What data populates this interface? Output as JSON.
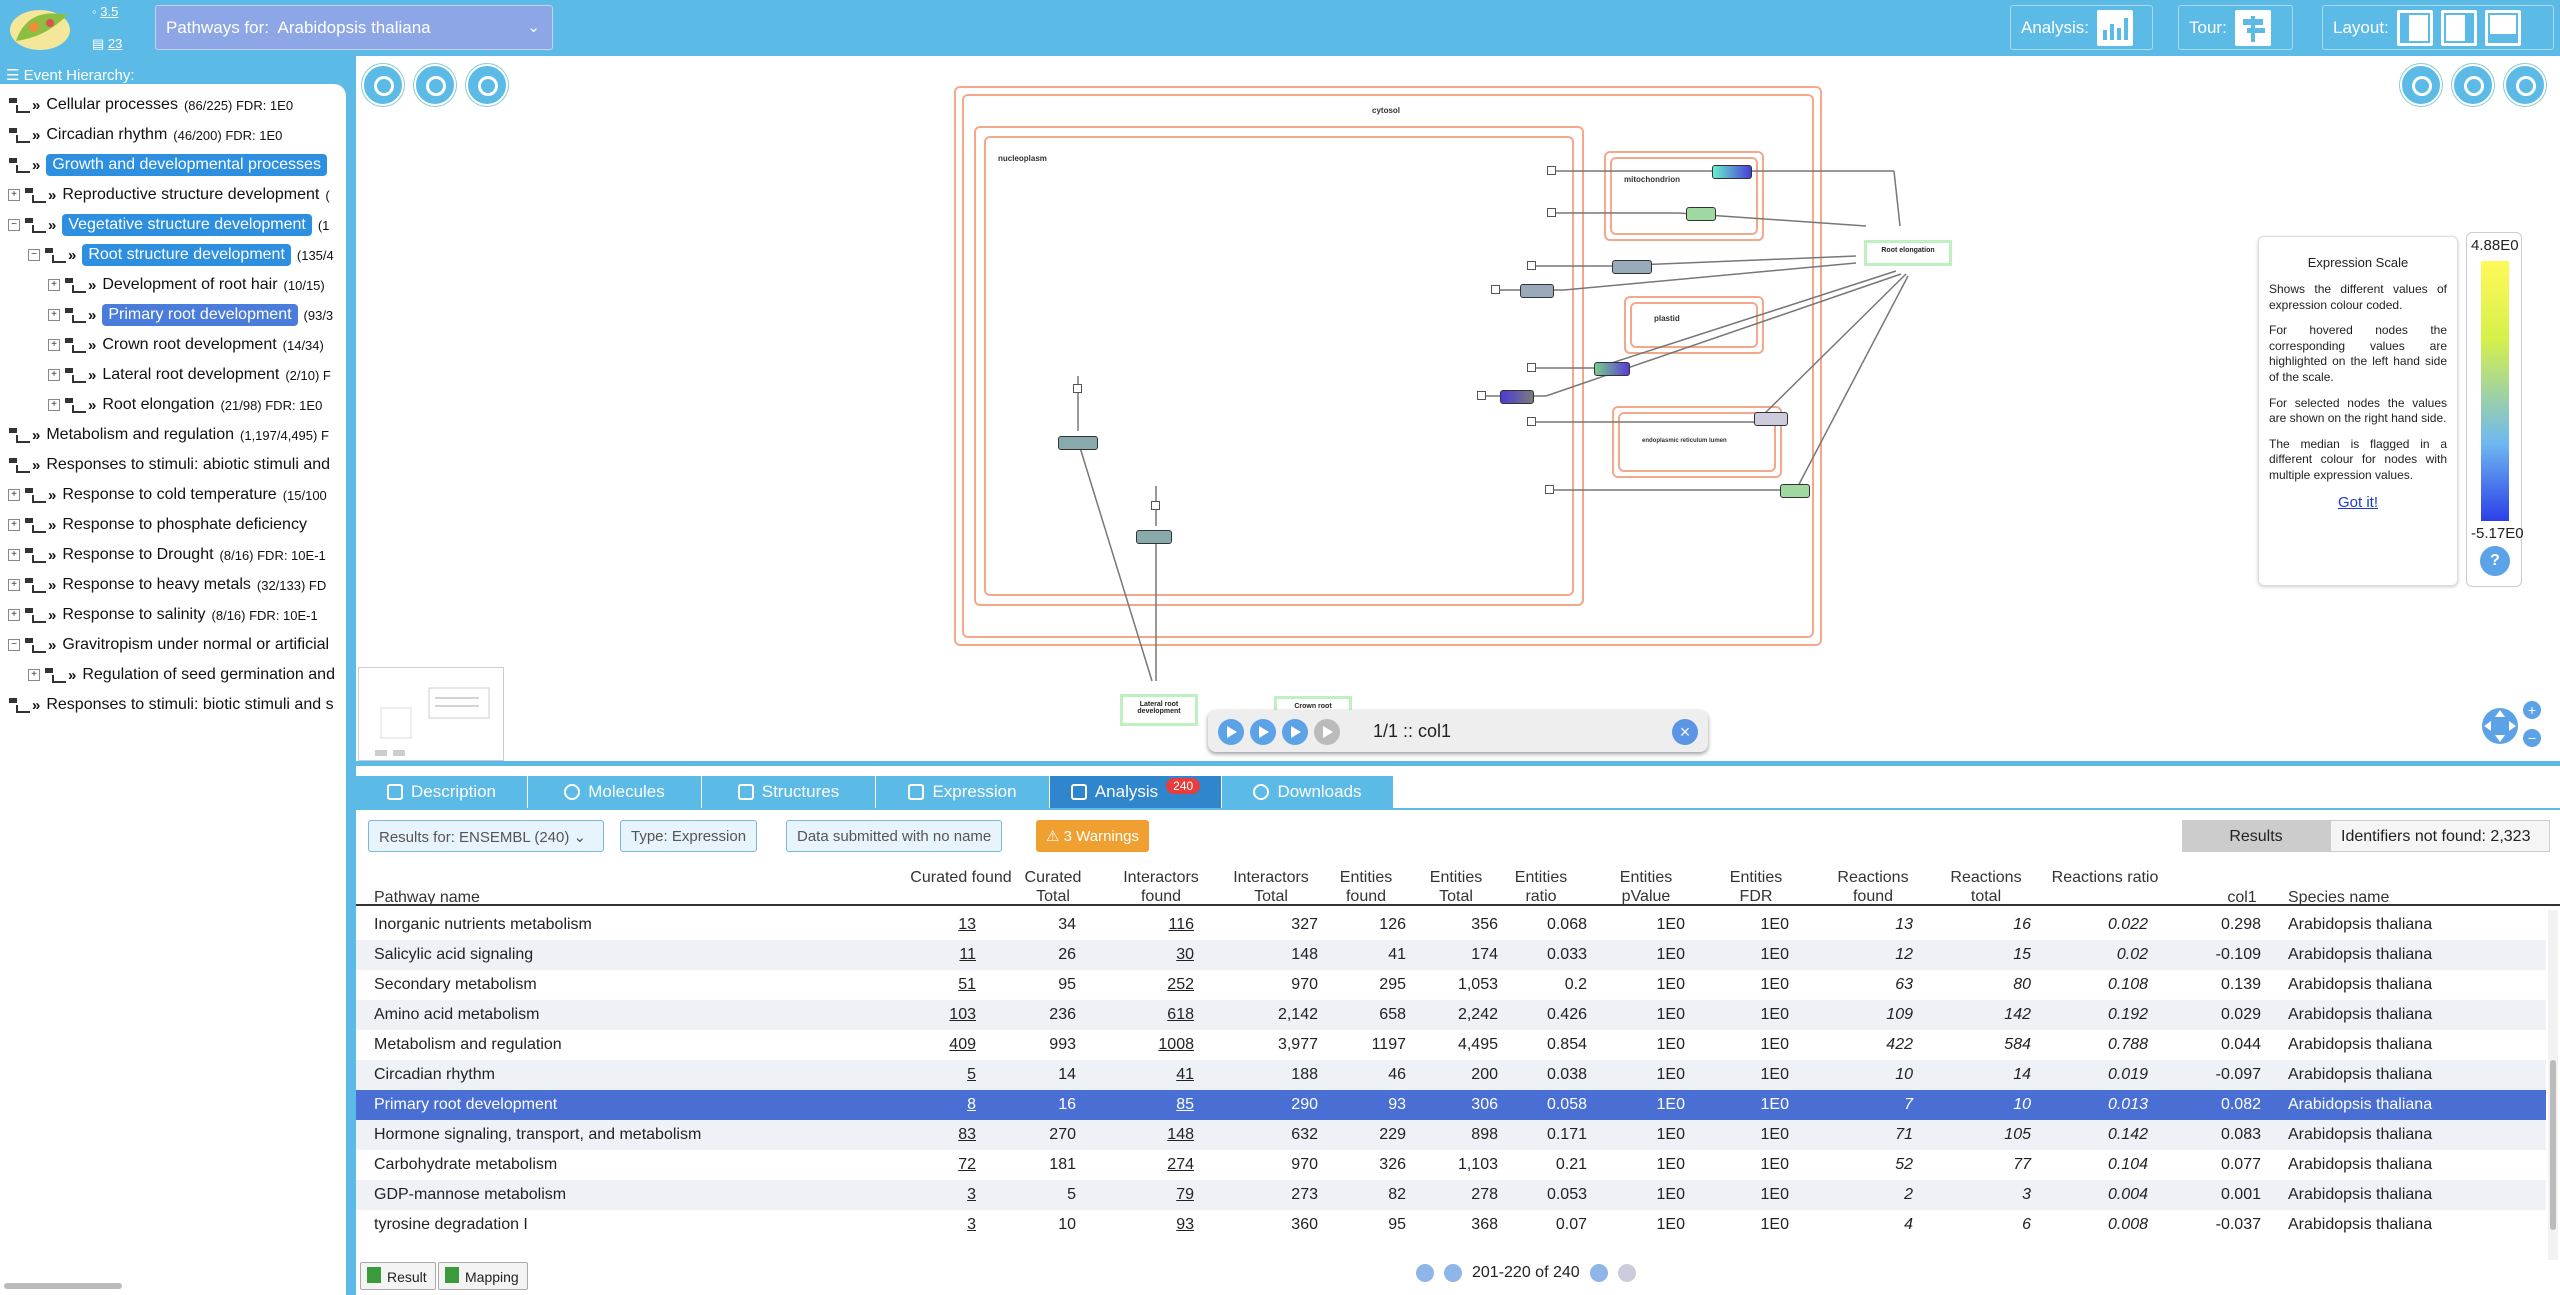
{
  "header": {
    "version_label": "3.5",
    "count_label": "23",
    "species_prefix": "Pathways for:",
    "species": "Arabidopsis thaliana",
    "analysis_label": "Analysis:",
    "tour_label": "Tour:",
    "layout_label": "Layout:"
  },
  "hierarchy": {
    "title": "Event Hierarchy:",
    "items": [
      {
        "label": "Cellular processes",
        "stat": "(86/225) FDR: 1E0"
      },
      {
        "label": "Circadian rhythm",
        "stat": "(46/200) FDR: 1E0"
      },
      {
        "label": "Growth and developmental processes",
        "stat": ""
      },
      {
        "label": "Reproductive structure development",
        "stat": "("
      },
      {
        "label": "Vegetative structure development",
        "stat": "(1"
      },
      {
        "label": "Root structure development",
        "stat": "(135/4"
      },
      {
        "label": "Development of root hair",
        "stat": "(10/15)"
      },
      {
        "label": "Primary root development",
        "stat": "(93/3"
      },
      {
        "label": "Crown root development",
        "stat": "(14/34)"
      },
      {
        "label": "Lateral root development",
        "stat": "(2/10) F"
      },
      {
        "label": "Root elongation",
        "stat": "(21/98) FDR: 1E0"
      },
      {
        "label": "Metabolism and regulation",
        "stat": "(1,197/4,495) F"
      },
      {
        "label": "Responses to stimuli: abiotic stimuli and",
        "stat": ""
      },
      {
        "label": "Response to cold temperature",
        "stat": "(15/100"
      },
      {
        "label": "Response to phosphate deficiency",
        "stat": ""
      },
      {
        "label": "Response to Drought",
        "stat": "(8/16) FDR: 10E-1"
      },
      {
        "label": "Response to heavy metals",
        "stat": "(32/133) FD"
      },
      {
        "label": "Response to salinity",
        "stat": "(8/16) FDR: 10E-1"
      },
      {
        "label": "Gravitropism under normal or artificial",
        "stat": ""
      },
      {
        "label": "Regulation of seed germination and",
        "stat": ""
      },
      {
        "label": "Responses to stimuli: biotic stimuli and s",
        "stat": ""
      }
    ]
  },
  "diagram": {
    "compartments": {
      "cytosol": "cytosol",
      "nucleoplasm": "nucleoplasm",
      "mitochondrion": "mitochondrion",
      "plastid": "plastid",
      "er_lumen": "endoplasmic reticulum lumen"
    },
    "outputs": {
      "root_elongation": "Root elongation",
      "lateral_root": "Lateral root development",
      "crown_root": "Crown root"
    },
    "player_label": "1/1 :: col1"
  },
  "legend": {
    "title": "Expression Scale",
    "p1": "Shows the different values of expression colour coded.",
    "p2": "For hovered nodes the corresponding values are highlighted on the left hand side of the scale.",
    "p3": "For selected nodes the values are shown on the right hand side.",
    "p4": "The median is flagged in a different colour for nodes with multiple expression values.",
    "got_it": "Got it!",
    "max": "4.88E0",
    "min": "-5.17E0",
    "help": "?"
  },
  "tabs": {
    "description": "Description",
    "molecules": "Molecules",
    "structures": "Structures",
    "expression": "Expression",
    "analysis": "Analysis",
    "analysis_badge": "240",
    "downloads": "Downloads"
  },
  "analysis": {
    "results_for": "Results for:  ENSEMBL (240)",
    "type": "Type: Expression",
    "data_name": "Data submitted with no name",
    "warnings": "3 Warnings",
    "results_tab": "Results",
    "not_found": "Identifiers not found: 2,323",
    "columns": [
      "Pathway name",
      "Curated found",
      "Curated Total",
      "Interactors found",
      "Interactors Total",
      "Entities found",
      "Entities Total",
      "Entities ratio",
      "Entities pValue",
      "Entities FDR",
      "Reactions found",
      "Reactions total",
      "Reactions ratio",
      "col1",
      "Species name"
    ],
    "rows": [
      [
        "Inorganic nutrients metabolism",
        "13",
        "34",
        "116",
        "327",
        "126",
        "356",
        "0.068",
        "1E0",
        "1E0",
        "13",
        "16",
        "0.022",
        "0.298",
        "Arabidopsis thaliana"
      ],
      [
        "Salicylic acid signaling",
        "11",
        "26",
        "30",
        "148",
        "41",
        "174",
        "0.033",
        "1E0",
        "1E0",
        "12",
        "15",
        "0.02",
        "-0.109",
        "Arabidopsis thaliana"
      ],
      [
        "Secondary metabolism",
        "51",
        "95",
        "252",
        "970",
        "295",
        "1,053",
        "0.2",
        "1E0",
        "1E0",
        "63",
        "80",
        "0.108",
        "0.139",
        "Arabidopsis thaliana"
      ],
      [
        "Amino acid metabolism",
        "103",
        "236",
        "618",
        "2,142",
        "658",
        "2,242",
        "0.426",
        "1E0",
        "1E0",
        "109",
        "142",
        "0.192",
        "0.029",
        "Arabidopsis thaliana"
      ],
      [
        "Metabolism and regulation",
        "409",
        "993",
        "1008",
        "3,977",
        "1197",
        "4,495",
        "0.854",
        "1E0",
        "1E0",
        "422",
        "584",
        "0.788",
        "0.044",
        "Arabidopsis thaliana"
      ],
      [
        "Circadian rhythm",
        "5",
        "14",
        "41",
        "188",
        "46",
        "200",
        "0.038",
        "1E0",
        "1E0",
        "10",
        "14",
        "0.019",
        "-0.097",
        "Arabidopsis thaliana"
      ],
      [
        "Primary root development",
        "8",
        "16",
        "85",
        "290",
        "93",
        "306",
        "0.058",
        "1E0",
        "1E0",
        "7",
        "10",
        "0.013",
        "0.082",
        "Arabidopsis thaliana"
      ],
      [
        "Hormone signaling, transport, and metabolism",
        "83",
        "270",
        "148",
        "632",
        "229",
        "898",
        "0.171",
        "1E0",
        "1E0",
        "71",
        "105",
        "0.142",
        "0.083",
        "Arabidopsis thaliana"
      ],
      [
        "Carbohydrate metabolism",
        "72",
        "181",
        "274",
        "970",
        "326",
        "1,103",
        "0.21",
        "1E0",
        "1E0",
        "52",
        "77",
        "0.104",
        "0.077",
        "Arabidopsis thaliana"
      ],
      [
        "GDP-mannose metabolism",
        "3",
        "5",
        "79",
        "273",
        "82",
        "278",
        "0.053",
        "1E0",
        "1E0",
        "2",
        "3",
        "0.004",
        "0.001",
        "Arabidopsis thaliana"
      ],
      [
        "tyrosine degradation I",
        "3",
        "10",
        "93",
        "360",
        "95",
        "368",
        "0.07",
        "1E0",
        "1E0",
        "4",
        "6",
        "0.008",
        "-0.037",
        "Arabidopsis thaliana"
      ]
    ],
    "selected_row": 6,
    "pager": "201-220 of 240",
    "result_btn": "Result",
    "mapping_btn": "Mapping"
  },
  "colors": {
    "brand": "#5bbbe6",
    "selected_row": "#4a6fd4",
    "warning": "#f0a030",
    "badge": "#e83d3d"
  }
}
